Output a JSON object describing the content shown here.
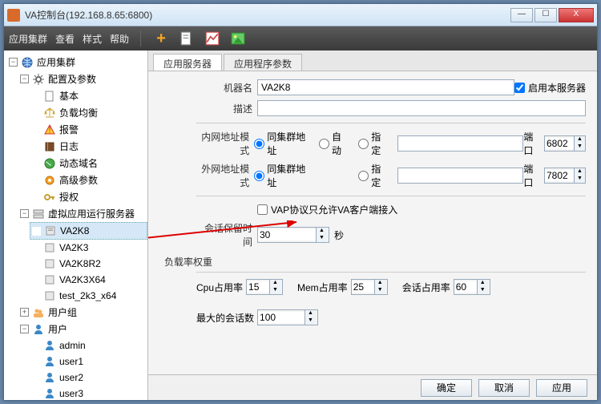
{
  "title": "VA控制台(192.168.8.65:6800)",
  "menu": {
    "cluster": "应用集群",
    "view": "查看",
    "style": "样式",
    "help": "帮助"
  },
  "tree": {
    "root": "应用集群",
    "cfg": "配置及参数",
    "cfg_items": {
      "basic": "基本",
      "lb": "负载均衡",
      "alarm": "报警",
      "log": "日志",
      "ddns": "动态域名",
      "adv": "高级参数",
      "auth": "授权"
    },
    "vserver": "虚拟应用运行服务器",
    "vitems": {
      "v1": "VA2K8",
      "v2": "VA2K3",
      "v3": "VA2K8R2",
      "v4": "VA2K3X64",
      "v5": "test_2k3_x64"
    },
    "ugroup": "用户组",
    "user": "用户",
    "users": {
      "u1": "admin",
      "u2": "user1",
      "u3": "user2",
      "u4": "user3"
    }
  },
  "tabs": {
    "t1": "应用服务器",
    "t2": "应用程序参数"
  },
  "form": {
    "host_label": "机器名",
    "host_value": "VA2K8",
    "enable_label": "启用本服务器",
    "desc_label": "描述",
    "desc_value": "",
    "inner_label": "内网地址模式",
    "outer_label": "外网地址模式",
    "r_same": "同集群地址",
    "r_auto": "自动",
    "r_spec": "指定",
    "port_label": "端口",
    "port_inner": "6802",
    "port_outer": "7802",
    "vap_label": "VAP协议只允许VA客户端接入",
    "keep_label": "会话保留时间",
    "keep_value": "30",
    "keep_unit": "秒",
    "load_title": "负载率权重",
    "cpu_label": "Cpu占用率",
    "cpu_value": "15",
    "mem_label": "Mem占用率",
    "mem_value": "25",
    "sess_label": "会话占用率",
    "sess_value": "60",
    "max_label": "最大的会话数",
    "max_value": "100"
  },
  "buttons": {
    "ok": "确定",
    "cancel": "取消",
    "apply": "应用"
  }
}
